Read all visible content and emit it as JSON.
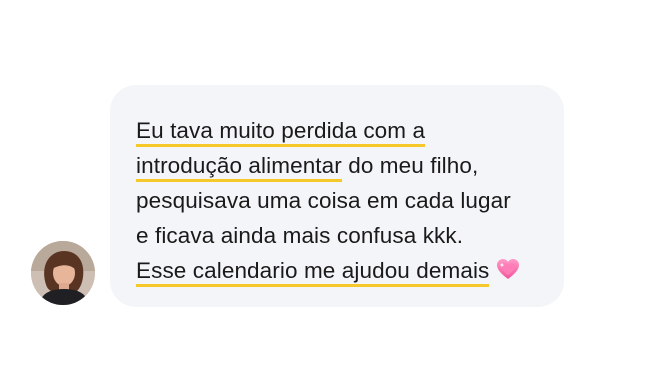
{
  "message": {
    "lines": [
      {
        "highlight": "Eu tava muito perdida com a",
        "rest": ""
      },
      {
        "highlight": "introdução alimentar",
        "rest": " do meu filho,"
      },
      {
        "highlight": "",
        "rest": "pesquisava uma coisa em cada lugar"
      },
      {
        "highlight": "",
        "rest": "e ficava ainda mais confusa kkk."
      },
      {
        "highlight": "Esse calendario me ajudou demais",
        "rest": ""
      }
    ],
    "emoji": "sparkling-heart-icon"
  },
  "avatar": {
    "icon": "user-photo"
  },
  "colors": {
    "bubble_bg": "#f4f5f8",
    "highlight": "#f7c82a",
    "text": "#1a1a1a"
  }
}
